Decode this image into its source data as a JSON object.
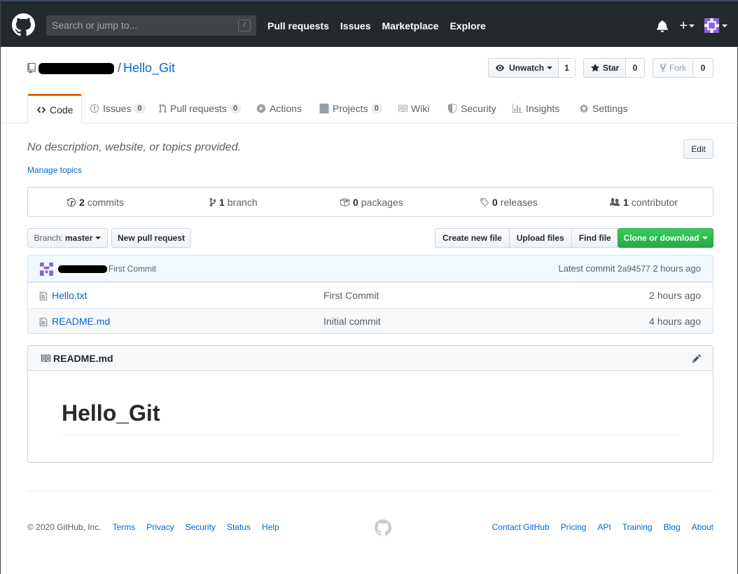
{
  "header": {
    "search_placeholder": "Search or jump to...",
    "search_key": "/",
    "nav": [
      "Pull requests",
      "Issues",
      "Marketplace",
      "Explore"
    ],
    "plus": "+"
  },
  "repo": {
    "separator": "/",
    "name": "Hello_Git",
    "watch_label": "Unwatch",
    "watch_count": "1",
    "star_label": "Star",
    "star_count": "0",
    "fork_label": "Fork",
    "fork_count": "0"
  },
  "tabs": [
    {
      "label": "Code",
      "count": ""
    },
    {
      "label": "Issues",
      "count": "0"
    },
    {
      "label": "Pull requests",
      "count": "0"
    },
    {
      "label": "Actions",
      "count": ""
    },
    {
      "label": "Projects",
      "count": "0"
    },
    {
      "label": "Wiki",
      "count": ""
    },
    {
      "label": "Security",
      "count": ""
    },
    {
      "label": "Insights",
      "count": ""
    },
    {
      "label": "Settings",
      "count": ""
    }
  ],
  "about": {
    "description": "No description, website, or topics provided.",
    "manage_topics": "Manage topics",
    "edit_label": "Edit"
  },
  "summary": [
    {
      "num": "2",
      "label": "commits"
    },
    {
      "num": "1",
      "label": "branch"
    },
    {
      "num": "0",
      "label": "packages"
    },
    {
      "num": "0",
      "label": "releases"
    },
    {
      "num": "1",
      "label": "contributor"
    }
  ],
  "filenav": {
    "branch_prefix": "Branch:",
    "branch_name": "master",
    "new_pr": "New pull request",
    "create_file": "Create new file",
    "upload_files": "Upload files",
    "find_file": "Find file",
    "clone": "Clone or download"
  },
  "commit": {
    "message": "First Commit",
    "latest_label": "Latest commit",
    "sha": "2a94577",
    "age": "2 hours ago"
  },
  "files": [
    {
      "name": "Hello.txt",
      "message": "First Commit",
      "age": "2 hours ago"
    },
    {
      "name": "README.md",
      "message": "Initial commit",
      "age": "4 hours ago"
    }
  ],
  "readme": {
    "title": "README.md",
    "heading": "Hello_Git"
  },
  "footer": {
    "copyright": "© 2020 GitHub, Inc.",
    "left_links": [
      "Terms",
      "Privacy",
      "Security",
      "Status",
      "Help"
    ],
    "right_links": [
      "Contact GitHub",
      "Pricing",
      "API",
      "Training",
      "Blog",
      "About"
    ]
  },
  "colors": {
    "header_bg": "#24292e",
    "link": "#0366d6",
    "accent_tab": "#e36209",
    "clone_green": "#28a745"
  },
  "icons": [
    "github-logo-icon",
    "bell-icon",
    "plus-icon",
    "repo-icon",
    "eye-icon",
    "star-icon",
    "fork-icon",
    "code-icon",
    "issue-icon",
    "pull-request-icon",
    "play-icon",
    "project-icon",
    "book-icon",
    "shield-icon",
    "graph-icon",
    "gear-icon",
    "history-icon",
    "branch-icon",
    "package-icon",
    "tag-icon",
    "people-icon",
    "file-icon",
    "pencil-icon"
  ]
}
